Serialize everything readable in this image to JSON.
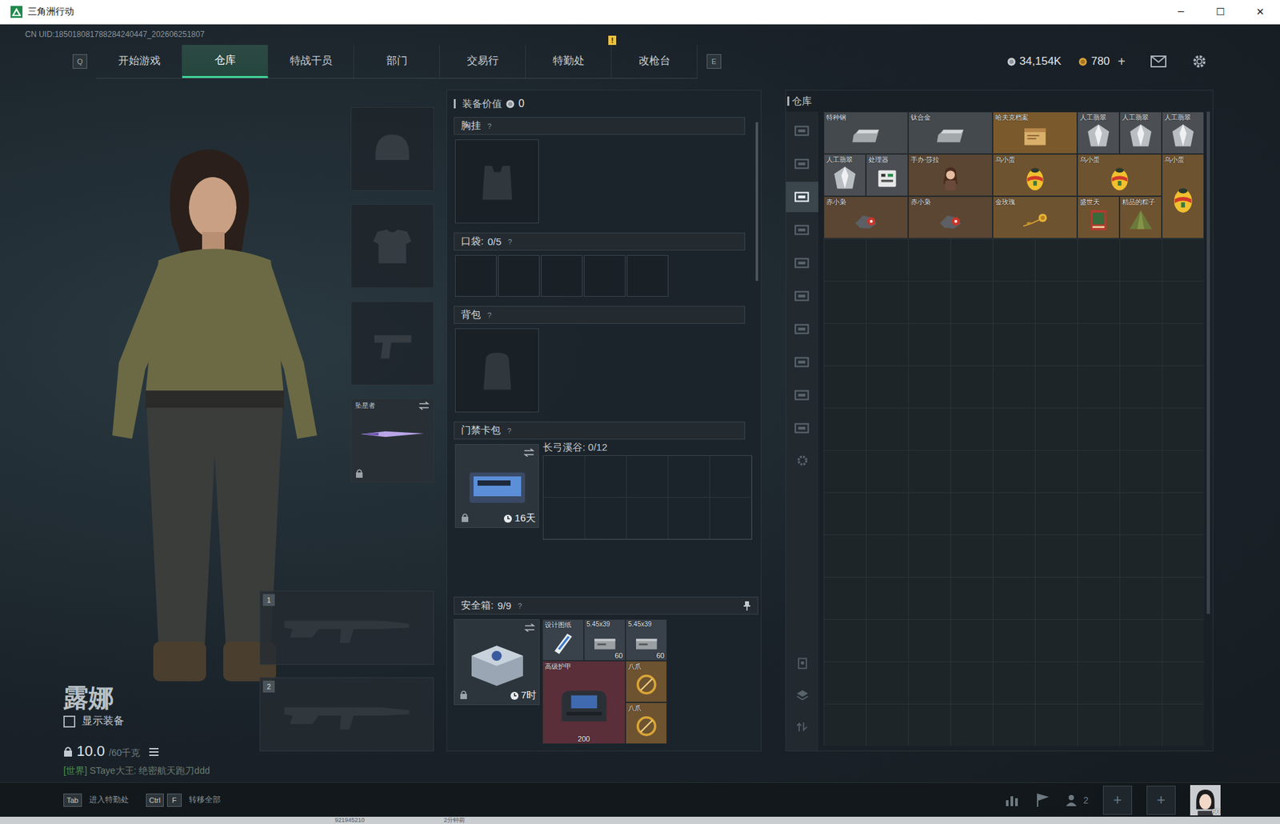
{
  "window": {
    "title": "三角洲行动",
    "controls": [
      "─",
      "☐",
      "✕"
    ]
  },
  "uid": "CN UID:185018081788284240447_202606251807",
  "nav": {
    "left_key": "Q",
    "right_key": "E",
    "tabs": [
      {
        "label": "开始游戏",
        "selected": false,
        "badge": null
      },
      {
        "label": "仓库",
        "selected": true,
        "badge": null
      },
      {
        "label": "特战干员",
        "selected": false,
        "badge": null
      },
      {
        "label": "部门",
        "selected": false,
        "badge": null
      },
      {
        "label": "交易行",
        "selected": false,
        "badge": null
      },
      {
        "label": "特勤处",
        "selected": false,
        "badge": "!"
      },
      {
        "label": "改枪台",
        "selected": false,
        "badge": null
      }
    ],
    "currency": [
      {
        "value": "34,154K",
        "suffix": ""
      },
      {
        "value": "780",
        "suffix": "+"
      }
    ]
  },
  "character": {
    "name": "露娜",
    "show_gear": {
      "label": "显示装备",
      "checked": false
    },
    "weight": "10.0",
    "weight_max": "/60千克"
  },
  "chat": {
    "channel": "[世界]",
    "text": "STaye大王: 绝密航天跑刀ddd"
  },
  "melee": {
    "label": "坠星者",
    "locked": true
  },
  "weapon_slots": [
    "1",
    "2"
  ],
  "loadout": {
    "value_label": "装备价值",
    "value": "0",
    "sections": [
      {
        "title": "胸挂",
        "count": "",
        "help": "?",
        "kind": "chest",
        "slots": 1
      },
      {
        "title": "口袋:",
        "count": "0/5",
        "help": "?",
        "kind": "pockets",
        "slots": 5
      },
      {
        "title": "背包",
        "count": "",
        "help": "?",
        "kind": "backpack",
        "slots": 1
      },
      {
        "title": "门禁卡包",
        "count": "",
        "help": "?",
        "kind": "cardbag",
        "slots": 1
      }
    ],
    "card": {
      "timer": "16天",
      "locked": true,
      "zone": "长弓溪谷: 0/12"
    },
    "safebox": {
      "title": "安全箱:",
      "count": "9/9",
      "help": "?",
      "timer": "7时",
      "locked": true,
      "items": [
        {
          "label": "设计图纸",
          "w": 1,
          "h": 1,
          "kind": "blueprint",
          "count": "",
          "color": "#39414a"
        },
        {
          "label": "5.45x39",
          "w": 1,
          "h": 1,
          "kind": "ammo",
          "count": "60",
          "color": "#39414a"
        },
        {
          "label": "5.45x39",
          "w": 1,
          "h": 1,
          "kind": "ammo",
          "count": "60",
          "color": "#39414a"
        },
        {
          "label": "高级护甲",
          "w": 2,
          "h": 2,
          "kind": "armor",
          "count": "200",
          "color": "#5a2f3a"
        },
        {
          "label": "八爪",
          "w": 1,
          "h": 1,
          "kind": "ring",
          "count": "",
          "color": "#6e5330"
        },
        {
          "label": "八爪",
          "w": 1,
          "h": 1,
          "kind": "ring",
          "count": "",
          "color": "#6e5330"
        }
      ]
    }
  },
  "warehouse": {
    "title": "仓库",
    "sidebar": [
      {
        "selected": false
      },
      {
        "selected": false
      },
      {
        "selected": true
      },
      {
        "selected": false
      },
      {
        "selected": false
      },
      {
        "selected": false
      },
      {
        "selected": false
      },
      {
        "selected": false
      },
      {
        "selected": false
      },
      {
        "selected": false
      }
    ],
    "items": [
      {
        "label": "特种钢",
        "w": 2,
        "h": 1,
        "kind": "ingot",
        "color": "#44494d"
      },
      {
        "label": "钛合金",
        "w": 2,
        "h": 1,
        "kind": "ingot",
        "color": "#44494d"
      },
      {
        "label": "哈夫克档案",
        "w": 2,
        "h": 1,
        "kind": "document",
        "color": "#7a5a2c"
      },
      {
        "label": "人工翡翠",
        "w": 1,
        "h": 1,
        "kind": "gem",
        "color": "#4b4f53"
      },
      {
        "label": "人工翡翠",
        "w": 1,
        "h": 1,
        "kind": "gem",
        "color": "#4b4f53"
      },
      {
        "label": "人工翡翠",
        "w": 1,
        "h": 1,
        "kind": "gem",
        "color": "#4b4f53"
      },
      {
        "label": "人工翡翠",
        "w": 1,
        "h": 1,
        "kind": "gem",
        "color": "#4b4f53"
      },
      {
        "label": "处理器",
        "w": 1,
        "h": 1,
        "kind": "chip",
        "color": "#4b4f53"
      },
      {
        "label": "手办·莎拉",
        "w": 2,
        "h": 1,
        "kind": "figure",
        "color": "#5a4633"
      },
      {
        "label": "乌小蛋",
        "w": 2,
        "h": 1,
        "kind": "egg",
        "color": "#6e5330"
      },
      {
        "label": "乌小蛋",
        "w": 2,
        "h": 1,
        "kind": "egg",
        "color": "#6e5330"
      },
      {
        "label": "乌小蛋",
        "w": 1,
        "h": 2,
        "kind": "egg",
        "color": "#6e5330"
      },
      {
        "label": "赤小枭",
        "w": 2,
        "h": 1,
        "kind": "bird",
        "color": "#5a4633"
      },
      {
        "label": "赤小枭",
        "w": 2,
        "h": 1,
        "kind": "bird",
        "color": "#5a4633"
      },
      {
        "label": "金玫瑰",
        "w": 2,
        "h": 1,
        "kind": "rose",
        "color": "#6e5330"
      },
      {
        "label": "盛世天",
        "w": 1,
        "h": 1,
        "kind": "card",
        "color": "#6e5330"
      },
      {
        "label": "精品的粽子",
        "w": 1,
        "h": 1,
        "kind": "dumpling",
        "color": "#6e5330"
      }
    ]
  },
  "bottom_bar": {
    "hints": [
      {
        "keys": [
          "Tab"
        ],
        "label": "进入特勤处"
      },
      {
        "keys": [
          "Ctrl",
          "F"
        ],
        "label": "转移全部"
      }
    ],
    "friends": "2",
    "plus_slots": [
      "+",
      "+"
    ],
    "level": "60"
  },
  "peek": {
    "id": "921945210",
    "time": "2分钟前"
  }
}
